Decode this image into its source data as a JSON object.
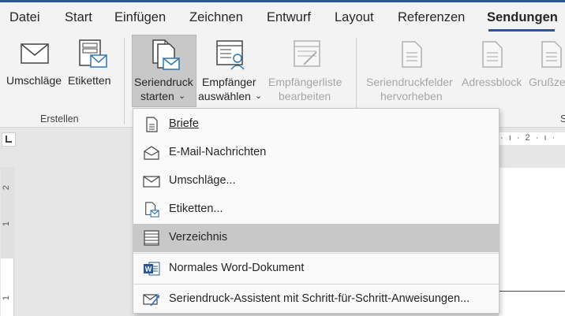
{
  "tabs": [
    {
      "label": "Datei"
    },
    {
      "label": "Start"
    },
    {
      "label": "Einfügen"
    },
    {
      "label": "Zeichnen"
    },
    {
      "label": "Entwurf"
    },
    {
      "label": "Layout"
    },
    {
      "label": "Referenzen"
    },
    {
      "label": "Sendungen",
      "active": true
    }
  ],
  "ribbon": {
    "umschlaege": "Umschläge",
    "etiketten": "Etiketten",
    "group_erstellen": "Erstellen",
    "seriendruck_line1": "Seriendruck",
    "seriendruck_line2": "starten",
    "empfaenger_line1": "Empfänger",
    "empfaenger_line2": "auswählen",
    "empfaengerliste_line1": "Empfängerliste",
    "empfaengerliste_line2": "bearbeiten",
    "seriendruckfelder_line1": "Seriendruckfelder",
    "seriendruckfelder_line2": "hervorheben",
    "adressblock": "Adressblock",
    "grusszeile": "Grußze",
    "group_cut": "S"
  },
  "menu": {
    "items": [
      {
        "label": "Briefe",
        "icon": "letter-icon"
      },
      {
        "label": "E-Mail-Nachrichten",
        "icon": "email-icon"
      },
      {
        "label": "Umschläge...",
        "icon": "envelope-icon"
      },
      {
        "label": "Etiketten...",
        "icon": "labels-icon"
      },
      {
        "label": "Verzeichnis",
        "icon": "directory-icon",
        "highlighted": true
      },
      {
        "label": "Normales Word-Dokument",
        "icon": "word-document-icon"
      },
      {
        "label": "Seriendruck-Assistent mit Schritt-für-Schritt-Anweisungen...",
        "icon": "wizard-icon"
      }
    ]
  },
  "ruler": {
    "h_text": "· ı · 2 · ı ·",
    "v_2": "2",
    "v_1": "1",
    "v_1b": "1"
  },
  "colors": {
    "accent": "#2b579a",
    "highlight": "#c8c8c8"
  }
}
